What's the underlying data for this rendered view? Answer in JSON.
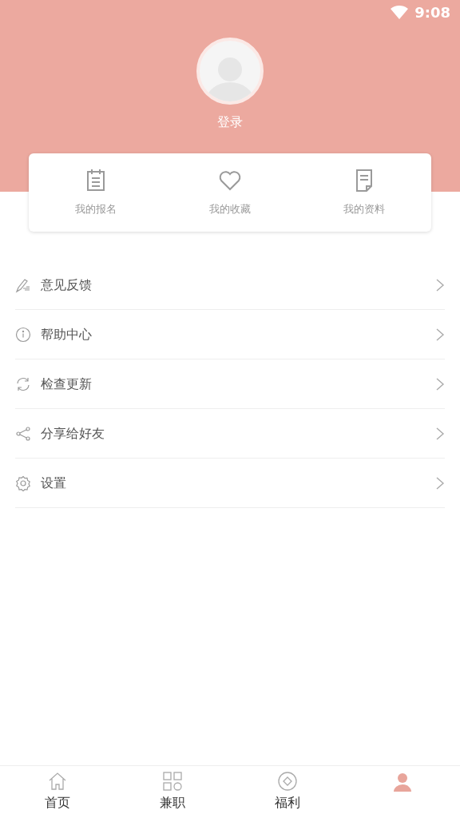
{
  "status_bar": {
    "time": "9:08"
  },
  "profile": {
    "login": "登录"
  },
  "shortcuts": [
    {
      "kind": "signup",
      "label": "我的报名"
    },
    {
      "kind": "favorite",
      "label": "我的收藏"
    },
    {
      "kind": "profile",
      "label": "我的资料"
    }
  ],
  "menu": [
    {
      "kind": "feedback",
      "label": "意见反馈"
    },
    {
      "kind": "help",
      "label": "帮助中心"
    },
    {
      "kind": "update",
      "label": "检查更新"
    },
    {
      "kind": "share",
      "label": "分享给好友"
    },
    {
      "kind": "settings",
      "label": "设置"
    }
  ],
  "tabs": [
    {
      "kind": "home",
      "label": "首页",
      "selected": false
    },
    {
      "kind": "jobs",
      "label": "兼职",
      "selected": false
    },
    {
      "kind": "welfare",
      "label": "福利",
      "selected": false
    },
    {
      "kind": "me",
      "selected": true
    }
  ]
}
